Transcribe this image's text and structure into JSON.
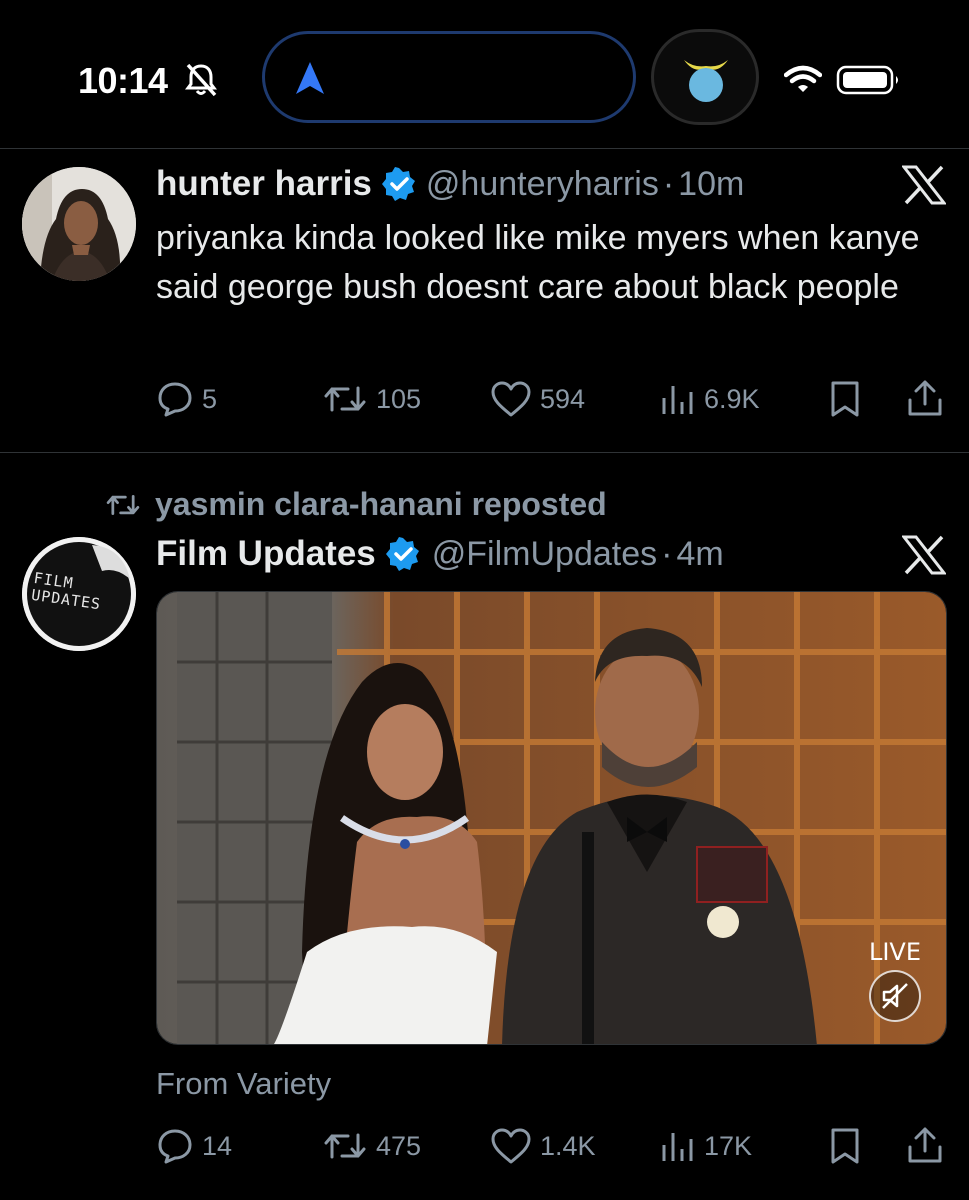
{
  "status_bar": {
    "time": "10:14",
    "icons": [
      "bell-slash-icon",
      "navigation-arrow-icon",
      "app-icon",
      "wifi-icon",
      "battery-icon"
    ]
  },
  "tweets": [
    {
      "name": "hunter harris",
      "handle": "@hunteryharris",
      "separator": "·",
      "time": "10m",
      "text": "priyanka kinda looked like mike myers when kanye said george bush doesnt care about black people",
      "replies": "5",
      "reposts": "105",
      "likes": "594",
      "views": "6.9K"
    },
    {
      "reposted_by": "yasmin clara-hanani reposted",
      "name": "Film Updates",
      "handle": "@FilmUpdates",
      "separator": "·",
      "time": "4m",
      "avatar_text": "FILM UPDATES",
      "media": {
        "live_label": "LIVE",
        "from": "From Variety"
      },
      "replies": "14",
      "reposts": "475",
      "likes": "1.4K",
      "views": "17K"
    }
  ],
  "colors": {
    "background": "#000000",
    "verified_blue": "#1d9bf0",
    "secondary_text": "#8b98a5",
    "divider": "#2f3336"
  }
}
